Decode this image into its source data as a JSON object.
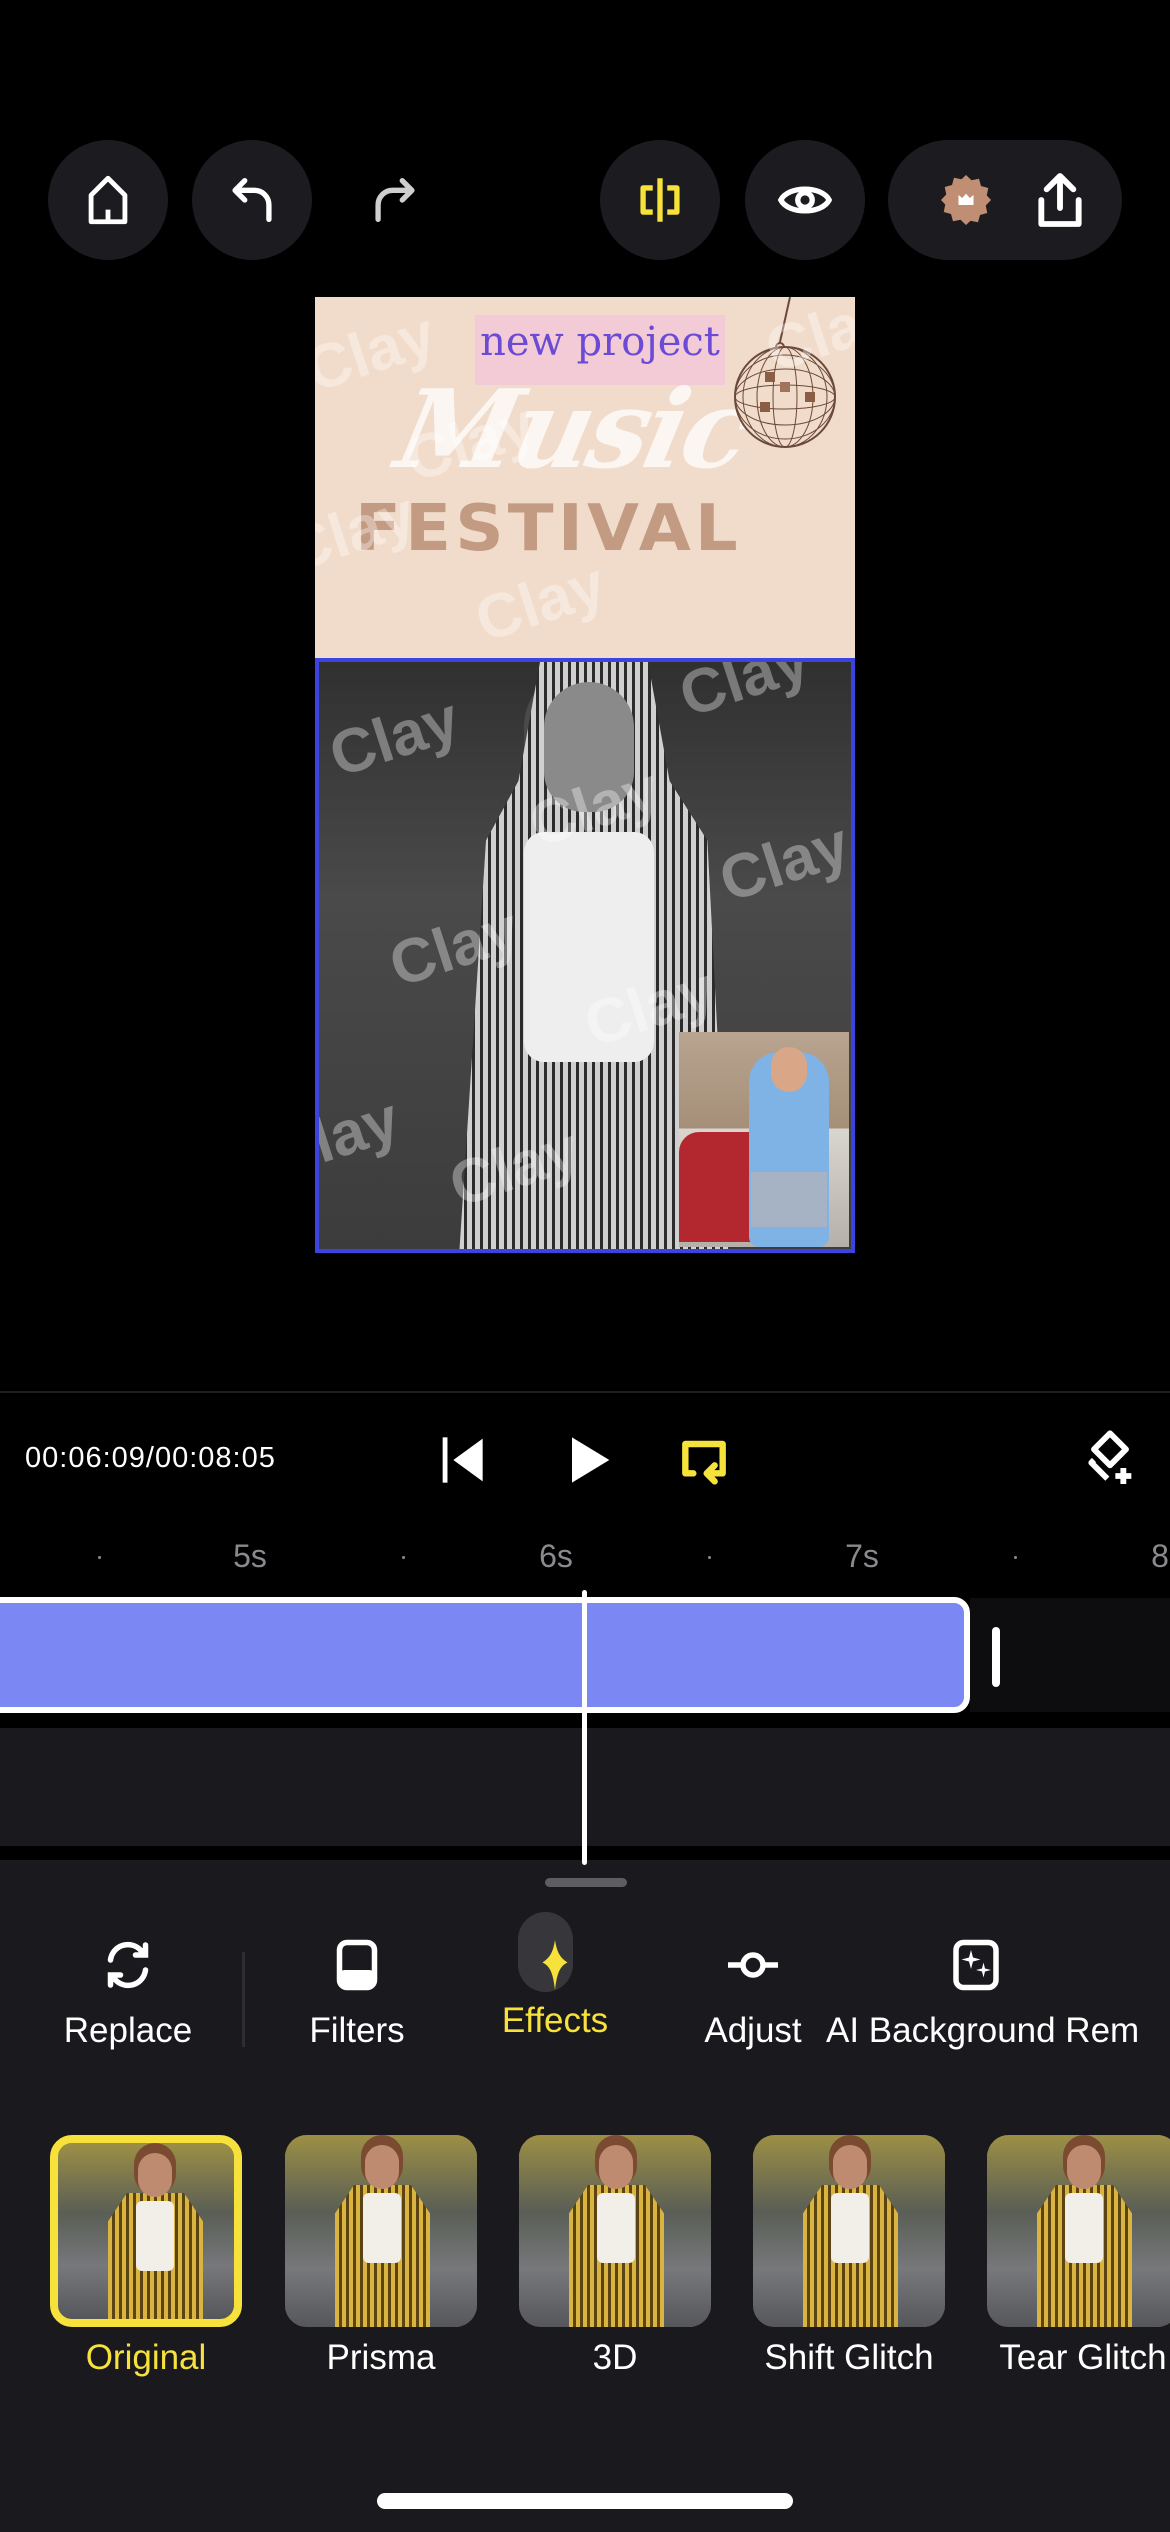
{
  "toolbar": {
    "home": {
      "icon": "home-icon"
    },
    "undo": {
      "icon": "undo-icon"
    },
    "redo": {
      "icon": "redo-icon"
    },
    "split": {
      "icon": "split-icon",
      "color": "#f6e23a"
    },
    "preview": {
      "icon": "eye-icon"
    },
    "premium": {
      "icon": "crown-badge-icon",
      "color": "#c08f73"
    },
    "export": {
      "icon": "share-icon"
    }
  },
  "canvas": {
    "poster": {
      "subtitle": "new project",
      "title_script": "Music",
      "title_block": "FESTIVAL",
      "background": "#f1dccb"
    },
    "watermark": "Clay",
    "selection_color": "#3b43e0"
  },
  "playback": {
    "current_time": "00:06:09",
    "separator": "/",
    "total_time": "00:08:05",
    "loop_color": "#f6e23a",
    "ruler": [
      "5s",
      "6s",
      "7s",
      "8"
    ]
  },
  "timeline": {
    "clip_color": "#7b87f2"
  },
  "tools": [
    {
      "label": "Replace",
      "icon": "replace-icon",
      "active": false
    },
    {
      "label": "Filters",
      "icon": "filters-icon",
      "active": false
    },
    {
      "label": "Effects",
      "icon": "effects-sparkle-icon",
      "active": true
    },
    {
      "label": "Adjust",
      "icon": "adjust-icon",
      "active": false
    },
    {
      "label": "AI Background Rem",
      "icon": "ai-background-icon",
      "active": false
    }
  ],
  "effects": [
    {
      "label": "Original",
      "selected": true
    },
    {
      "label": "Prisma",
      "selected": false
    },
    {
      "label": "3D",
      "selected": false
    },
    {
      "label": "Shift Glitch",
      "selected": false
    },
    {
      "label": "Tear Glitch",
      "selected": false
    }
  ],
  "accent_color": "#f6e23a"
}
